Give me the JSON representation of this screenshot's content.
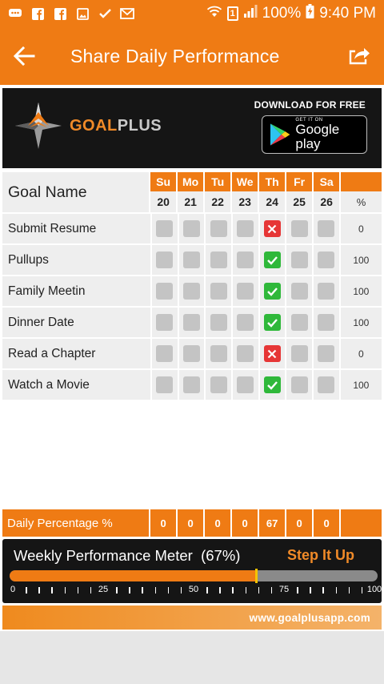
{
  "status_bar": {
    "battery": "100%",
    "time": "9:40 PM",
    "sim": "1",
    "left_icons": [
      "chat-icon",
      "facebook-icon",
      "facebook-icon",
      "image-icon",
      "check-icon",
      "mail-icon"
    ]
  },
  "app_bar": {
    "title": "Share Daily Performance"
  },
  "banner": {
    "logo_goal": "GOAL",
    "logo_plus": "PLUS",
    "download_label": "DOWNLOAD FOR FREE",
    "gplay_small": "GET IT ON",
    "gplay_big": "Google play"
  },
  "table": {
    "name_header": "Goal Name",
    "pct_header": "%",
    "days": [
      {
        "name": "Su",
        "num": "20"
      },
      {
        "name": "Mo",
        "num": "21"
      },
      {
        "name": "Tu",
        "num": "22"
      },
      {
        "name": "We",
        "num": "23"
      },
      {
        "name": "Th",
        "num": "24"
      },
      {
        "name": "Fr",
        "num": "25"
      },
      {
        "name": "Sa",
        "num": "26"
      }
    ],
    "goals": [
      {
        "name": "Submit Resume",
        "status": [
          "none",
          "none",
          "none",
          "none",
          "fail",
          "none",
          "none"
        ],
        "pct": "0"
      },
      {
        "name": "Pullups",
        "status": [
          "none",
          "none",
          "none",
          "none",
          "done",
          "none",
          "none"
        ],
        "pct": "100"
      },
      {
        "name": "Family Meetin",
        "status": [
          "none",
          "none",
          "none",
          "none",
          "done",
          "none",
          "none"
        ],
        "pct": "100"
      },
      {
        "name": "Dinner Date",
        "status": [
          "none",
          "none",
          "none",
          "none",
          "done",
          "none",
          "none"
        ],
        "pct": "100"
      },
      {
        "name": "Read a Chapter",
        "status": [
          "none",
          "none",
          "none",
          "none",
          "fail",
          "none",
          "none"
        ],
        "pct": "0"
      },
      {
        "name": "Watch a Movie",
        "status": [
          "none",
          "none",
          "none",
          "none",
          "done",
          "none",
          "none"
        ],
        "pct": "100"
      }
    ]
  },
  "daily": {
    "label": "Daily Percentage %",
    "values": [
      "0",
      "0",
      "0",
      "0",
      "67",
      "0",
      "0"
    ]
  },
  "meter": {
    "title": "Weekly Performance Meter",
    "percent_label": "(67%)",
    "percent": 67,
    "cta": "Step It Up",
    "scale_labels": [
      "0",
      "25",
      "50",
      "75",
      "100"
    ]
  },
  "footer": {
    "url": "www.goalplusapp.com"
  },
  "colors": {
    "accent": "#ef7b14",
    "done": "#2fb83a",
    "fail": "#e63636",
    "empty": "#c4c4c4"
  }
}
